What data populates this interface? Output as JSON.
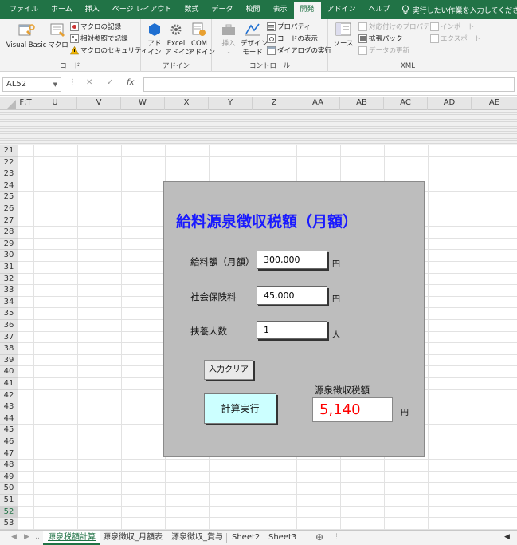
{
  "ribbon_tabs": [
    "ファイル",
    "ホーム",
    "挿入",
    "ページ レイアウト",
    "数式",
    "データ",
    "校閲",
    "表示",
    "開発",
    "アドイン",
    "ヘルプ"
  ],
  "active_tab": "開発",
  "tell_me": "実行したい作業を入力してください",
  "ribbon": {
    "code": {
      "visual_basic": "Visual Basic",
      "macro": "マクロ",
      "record": "マクロの記録",
      "relative": "相対参照で記録",
      "security": "マクロのセキュリティ",
      "label": "コード"
    },
    "addins": {
      "addin_line1": "アド",
      "addin_line2": "イン",
      "excel_line1": "Excel",
      "excel_line2": "アドイン",
      "com_line1": "COM",
      "com_line2": "アドイン",
      "label": "アドイン"
    },
    "controls": {
      "insert_line1": "挿入",
      "insert_line2": "-",
      "design_line1": "デザイン",
      "design_line2": "モード",
      "properties": "プロパティ",
      "view_code": "コードの表示",
      "dialog": "ダイアログの実行",
      "label": "コントロール"
    },
    "xml": {
      "source": "ソース",
      "map_props": "対応付けのプロパティ",
      "expansion": "拡張パック",
      "refresh": "データの更新",
      "import": "インポート",
      "export": "エクスポート",
      "label": "XML"
    }
  },
  "formula_bar": {
    "name_box": "AL52",
    "cancel": "✕",
    "enter": "✓",
    "fx": "fx",
    "formula": ""
  },
  "columns": [
    "F;T",
    "U",
    "V",
    "W",
    "X",
    "Y",
    "Z",
    "AA",
    "AB",
    "AC",
    "AD",
    "AE"
  ],
  "rows": [
    "21",
    "22",
    "23",
    "24",
    "25",
    "26",
    "27",
    "28",
    "29",
    "30",
    "31",
    "32",
    "33",
    "34",
    "35",
    "36",
    "37",
    "38",
    "39",
    "40",
    "41",
    "42",
    "43",
    "44",
    "45",
    "46",
    "47",
    "48",
    "49",
    "50",
    "51",
    "52",
    "53"
  ],
  "selected_row": "52",
  "form": {
    "title": "給料源泉徴収税額（月額）",
    "salary_label": "給料額（月額）",
    "salary_value": "300,000",
    "salary_unit": "円",
    "insurance_label": "社会保険料",
    "insurance_value": "45,000",
    "insurance_unit": "円",
    "dependents_label": "扶養人数",
    "dependents_value": "1",
    "dependents_unit": "人",
    "clear_button": "入力クリア",
    "calc_button": "計算実行",
    "result_label": "源泉徴収税額",
    "result_value": "5,140",
    "result_unit": "円"
  },
  "sheets": [
    "源泉税額計算",
    "源泉徴収_月額表",
    "源泉徴収_賞与",
    "Sheet2",
    "Sheet3"
  ],
  "active_sheet": "源泉税額計算",
  "add_sheet": "⊕",
  "colors": {
    "excel_green": "#217346",
    "title_blue": "#1a1aff",
    "result_red": "#ff0000",
    "calc_button": "#ccffff",
    "panel_gray": "#bdbdbd"
  }
}
